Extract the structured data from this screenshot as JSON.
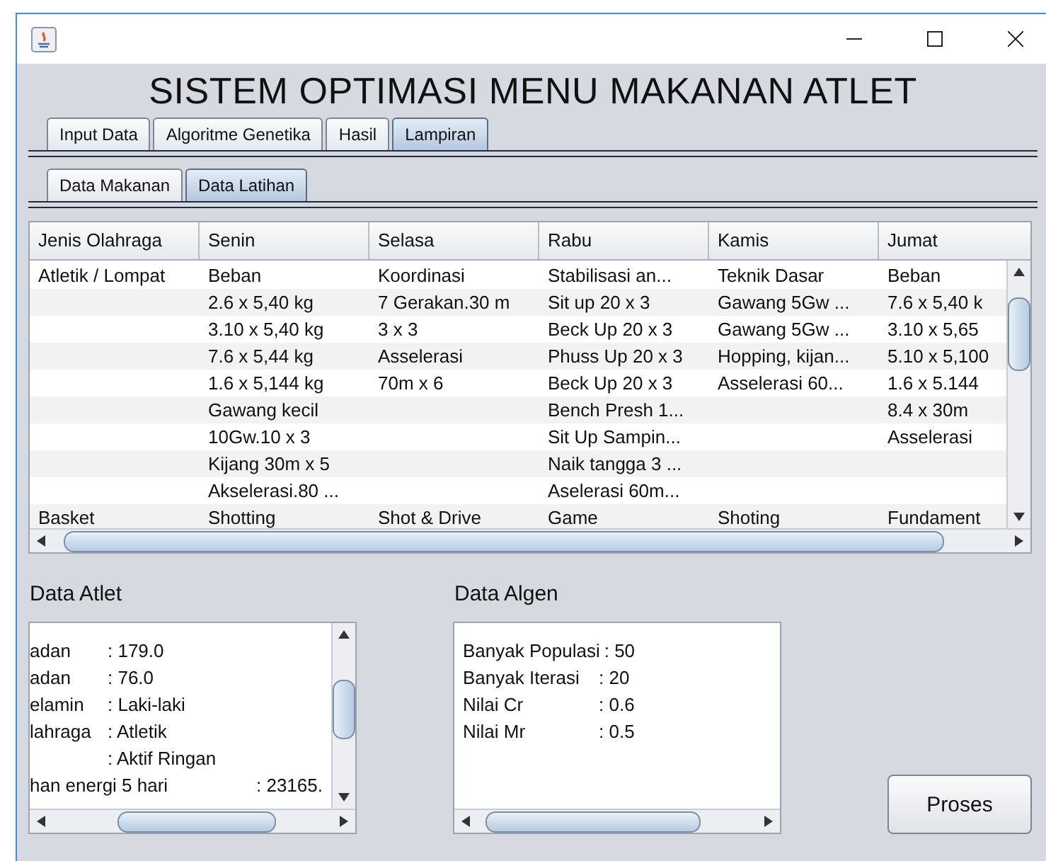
{
  "window": {
    "title": "SISTEM OPTIMASI MENU MAKANAN ATLET"
  },
  "tabs": [
    {
      "label": "Input Data",
      "selected": false
    },
    {
      "label": "Algoritme Genetika",
      "selected": false
    },
    {
      "label": "Hasil",
      "selected": false
    },
    {
      "label": "Lampiran",
      "selected": true
    }
  ],
  "subtabs": [
    {
      "label": "Data Makanan",
      "selected": false
    },
    {
      "label": "Data Latihan",
      "selected": true
    }
  ],
  "table": {
    "columns": [
      "Jenis Olahraga",
      "Senin",
      "Selasa",
      "Rabu",
      "Kamis",
      "Jumat"
    ],
    "rows": [
      [
        "Atletik / Lompat",
        "Beban",
        "Koordinasi",
        "Stabilisasi an...",
        "Teknik Dasar",
        "Beban"
      ],
      [
        null,
        "2.6 x 5,40 kg",
        "7 Gerakan.30 m",
        "Sit up 20 x 3",
        "Gawang 5Gw ...",
        "7.6 x 5,40 k"
      ],
      [
        null,
        "3.10 x 5,40 kg",
        "3 x 3",
        "Beck Up 20 x 3",
        "Gawang 5Gw ...",
        "3.10 x 5,65"
      ],
      [
        null,
        "7.6 x 5,44 kg",
        "Asselerasi",
        "Phuss Up 20 x 3",
        "Hopping, kijan...",
        "5.10 x 5,100"
      ],
      [
        null,
        "1.6 x 5,144 kg",
        "70m x 6",
        "Beck Up 20 x 3",
        "Asselerasi 60...",
        "1.6 x 5.144"
      ],
      [
        null,
        "Gawang kecil",
        null,
        "Bench Presh 1...",
        null,
        "8.4 x 30m"
      ],
      [
        null,
        "10Gw.10 x 3",
        null,
        "Sit Up Sampin...",
        null,
        "Asselerasi"
      ],
      [
        null,
        "Kijang 30m x 5",
        null,
        "Naik tangga 3 ...",
        null,
        null
      ],
      [
        null,
        "Akselerasi.80 ...",
        null,
        "Aselerasi 60m...",
        null,
        null
      ],
      [
        "Basket",
        "Shotting",
        "Shot & Drive",
        "Game",
        "Shoting",
        "Fundament"
      ]
    ]
  },
  "data_atlet": {
    "title": "Data Atlet",
    "lines": [
      {
        "label": "adan",
        "value": ": 179.0"
      },
      {
        "label": "adan",
        "value": ": 76.0"
      },
      {
        "label": "elamin",
        "value": ": Laki-laki"
      },
      {
        "label": "lahraga",
        "value": ": Atletik"
      },
      {
        "value": ": Aktif Ringan"
      },
      {
        "label": "han energi 5 hari",
        "value": ": 23165."
      }
    ]
  },
  "data_algen": {
    "title": "Data Algen",
    "lines": [
      {
        "label": "Banyak Populasi",
        "value": ": 50"
      },
      {
        "label": "Banyak Iterasi",
        "value": ": 20"
      },
      {
        "label": "Nilai Cr",
        "value": ": 0.6"
      },
      {
        "label": "Nilai Mr",
        "value": ": 0.5"
      }
    ]
  },
  "buttons": [
    "Proses"
  ]
}
